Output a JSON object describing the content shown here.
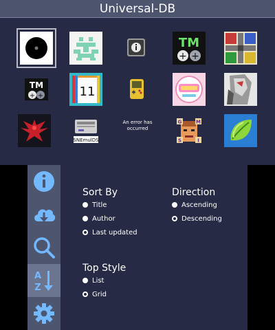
{
  "header": {
    "title": "Universal-DB"
  },
  "apps": [
    {
      "name": "black-disc",
      "selected": true
    },
    {
      "name": "green-pixel-sprite"
    },
    {
      "name": "info-box"
    },
    {
      "name": "tm-plus-minus"
    },
    {
      "name": "ludo-board"
    },
    {
      "name": "tm-small"
    },
    {
      "name": "calendar-11",
      "label": "11"
    },
    {
      "name": "gameboy-yellow"
    },
    {
      "name": "anime-logo"
    },
    {
      "name": "anime-character"
    },
    {
      "name": "red-phoenix"
    },
    {
      "name": "snes-console",
      "label": "SNEmulDS"
    },
    {
      "name": "error-text",
      "label": "An error has occurred"
    },
    {
      "name": "puzzle-face",
      "letters": [
        "G",
        "M",
        "S",
        "I"
      ]
    },
    {
      "name": "green-leaf"
    }
  ],
  "sidebar": {
    "items": [
      {
        "name": "info-icon",
        "active": false
      },
      {
        "name": "download-icon",
        "active": false
      },
      {
        "name": "search-icon",
        "active": false
      },
      {
        "name": "sort-az-icon",
        "active": true,
        "letters": [
          "A",
          "Z"
        ]
      },
      {
        "name": "gear-icon",
        "active": false
      }
    ]
  },
  "settings": {
    "sort_by": {
      "title": "Sort By",
      "options": [
        {
          "label": "Title",
          "selected": false
        },
        {
          "label": "Author",
          "selected": false
        },
        {
          "label": "Last updated",
          "selected": true
        }
      ]
    },
    "direction": {
      "title": "Direction",
      "options": [
        {
          "label": "Ascending",
          "selected": false
        },
        {
          "label": "Descending",
          "selected": true
        }
      ]
    },
    "top_style": {
      "title": "Top Style",
      "options": [
        {
          "label": "List",
          "selected": false
        },
        {
          "label": "Grid",
          "selected": true
        }
      ]
    }
  },
  "colors": {
    "background": "#262a44",
    "title_bar": "#4d556f",
    "sidebar": "#4d556f",
    "sidebar_active": "#6c7590",
    "icon": "#74b8ff",
    "text": "#ffffff"
  }
}
